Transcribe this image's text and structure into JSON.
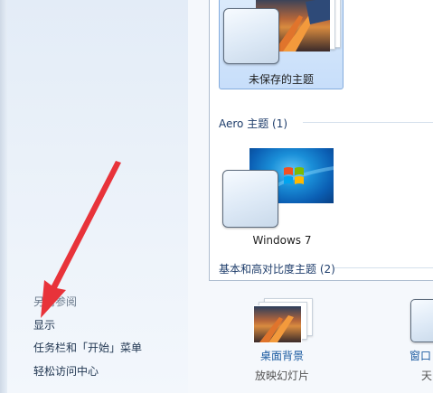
{
  "sidebar": {
    "see_also": "另请参阅",
    "links": [
      "显示",
      "任务栏和「开始」菜单",
      "轻松访问中心"
    ]
  },
  "themes": {
    "selected_theme_label": "未保存的主题",
    "aero_group_title": "Aero 主题 (1)",
    "windows7_label": "Windows 7",
    "basic_group_title": "基本和高对比度主题 (2)"
  },
  "bottom": {
    "desktop_background_title": "桌面背景",
    "desktop_background_sub": "放映幻灯片",
    "window_color_title": "窗口",
    "window_color_sub": "天"
  },
  "colors": {
    "annotation_arrow": "#e8333a",
    "link": "#1a5aa0"
  }
}
